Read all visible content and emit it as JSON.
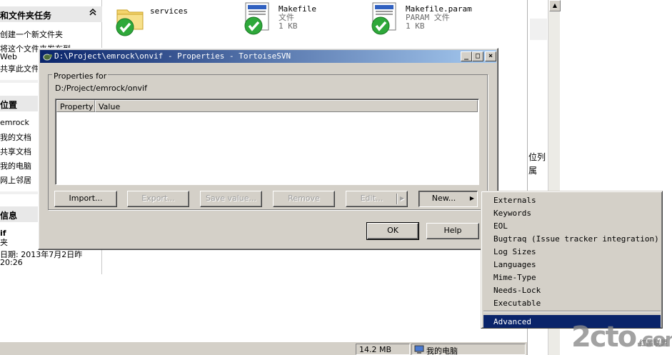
{
  "taskpane": {
    "sections": [
      {
        "title": "和文件夹任务",
        "items": [
          "创建一个新文件夹",
          "将这个文件夹发布到",
          "Web",
          "共享此文件"
        ]
      },
      {
        "title": "位置",
        "items": [
          "emrock",
          "我的文档",
          "共享文档",
          "我的电脑",
          "网上邻居"
        ]
      },
      {
        "title": "信息",
        "items": [
          "if",
          "夹",
          "日期: 2013年7月2日昨",
          "20:26"
        ]
      }
    ]
  },
  "files": [
    {
      "name": "services",
      "type": "",
      "size": ""
    },
    {
      "name": "Makefile",
      "type": "文件",
      "size": "1 KB"
    },
    {
      "name": "Makefile.param",
      "type": "PARAM 文件",
      "size": "1 KB"
    }
  ],
  "right_text": [
    "位列",
    "属"
  ],
  "statusbar": {
    "size": "14.2 MB",
    "location": "我的电脑"
  },
  "dialog": {
    "title": "D:\\Project\\emrock\\onvif - Properties - TortoiseSVN",
    "minimize": "_",
    "maximize": "□",
    "close": "×",
    "group_label": "Properties for",
    "path": "D:/Project/emrock/onvif",
    "columns": [
      "Property",
      "Value"
    ],
    "buttons": {
      "import": "Import...",
      "export": "Export...",
      "save_value": "Save value...",
      "remove": "Remove",
      "edit": "Edit...",
      "new": "New...",
      "ok": "OK",
      "help": "Help"
    }
  },
  "menu": {
    "items": [
      "Externals",
      "Keywords",
      "EOL",
      "Bugtraq (Issue tracker integration)",
      "Log Sizes",
      "Languages",
      "Mime-Type",
      "Needs-Lock",
      "Executable"
    ],
    "highlighted": "Advanced"
  },
  "watermark": {
    "text": "2cto",
    "suffix": ".com",
    "small": "红黑联盟"
  },
  "colors": {
    "title_start": "#0a246a",
    "title_end": "#a6caf0",
    "menu_highlight": "#0a246a",
    "face": "#d4d0c8"
  }
}
